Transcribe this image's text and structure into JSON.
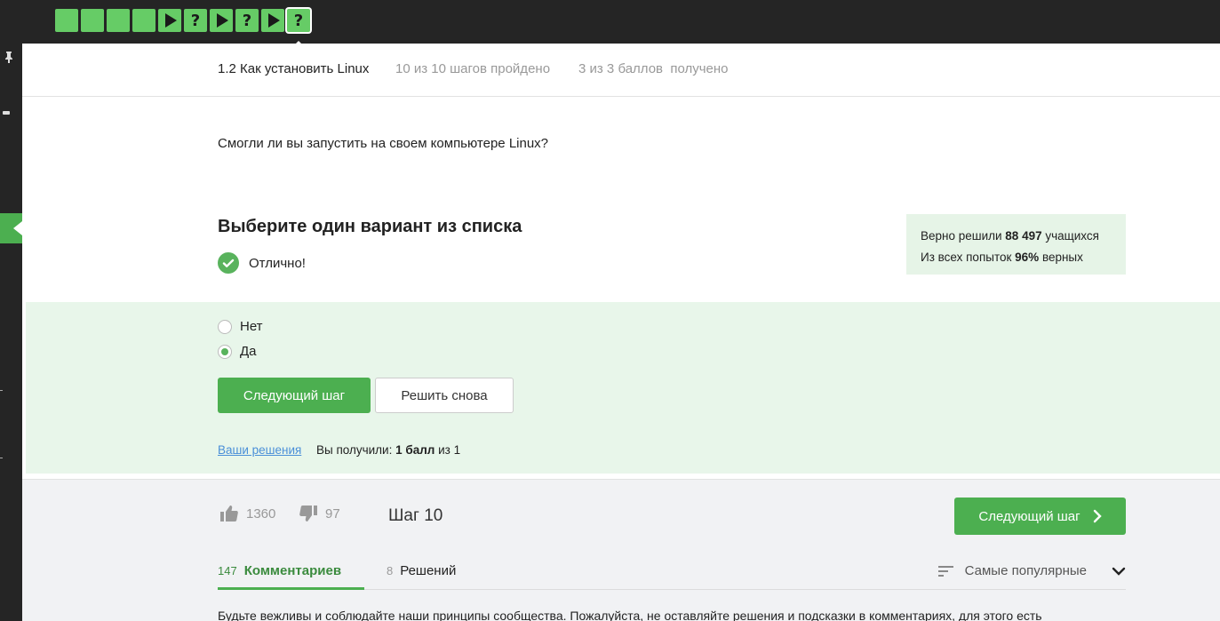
{
  "steps": [
    {
      "type": "done"
    },
    {
      "type": "done"
    },
    {
      "type": "done"
    },
    {
      "type": "done"
    },
    {
      "type": "play"
    },
    {
      "type": "question"
    },
    {
      "type": "play"
    },
    {
      "type": "question"
    },
    {
      "type": "play"
    },
    {
      "type": "question",
      "active": true
    }
  ],
  "step_question_glyph": "?",
  "lesson": {
    "title": "1.2 Как установить Linux",
    "steps_progress": "10 из 10 шагов пройдено",
    "points_progress": "3 из 3 баллов  получено"
  },
  "question_text": "Смогли ли вы запустить на своем компьютере Linux?",
  "choose_title": "Выберите один вариант из списка",
  "result_text": "Отлично!",
  "stats": {
    "solved_prefix": "Верно решили ",
    "solved_count": "88 497",
    "solved_suffix": " учащихся",
    "attempts_prefix": "Из всех попыток ",
    "attempts_percent": "96%",
    "attempts_suffix": " верных"
  },
  "options": [
    {
      "label": "Нет",
      "selected": false
    },
    {
      "label": "Да",
      "selected": true
    }
  ],
  "buttons": {
    "next_step": "Следующий шаг",
    "retry": "Решить снова"
  },
  "your_solutions_link": "Ваши решения",
  "score": {
    "prefix": "Вы получили: ",
    "value": "1 балл",
    "suffix": " из 1"
  },
  "footer": {
    "likes": "1360",
    "dislikes": "97",
    "step_label": "Шаг 10",
    "next_step": "Следующий шаг",
    "tabs": [
      {
        "count": "147",
        "label": "Комментариев",
        "active": true
      },
      {
        "count": "8",
        "label": "Решений",
        "active": false
      }
    ],
    "sort_label": "Самые популярные",
    "notice": "Будьте вежливы и соблюдайте наши принципы сообщества. Пожалуйста, не оставляйте решения и подсказки в комментариях, для этого есть"
  },
  "colors": {
    "accent": "#4caf50",
    "step_done": "#66cc66",
    "answer_bg": "#e8f6ea",
    "topbar": "#252525"
  }
}
